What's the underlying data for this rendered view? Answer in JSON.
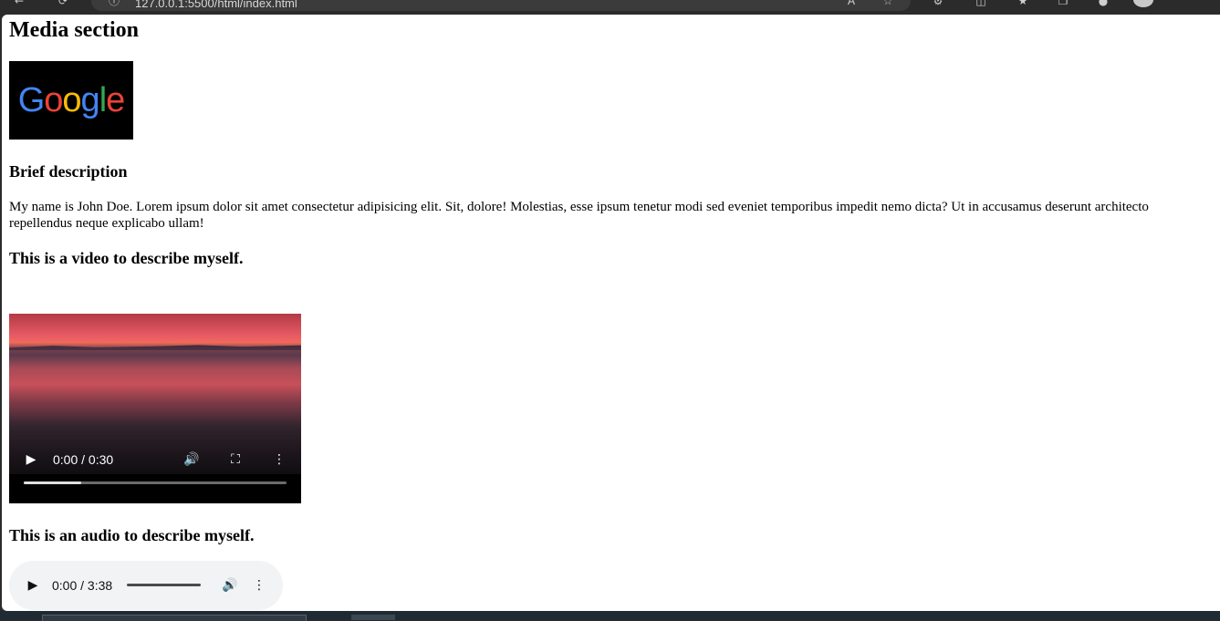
{
  "browser": {
    "url": "127.0.0.1:5500/html/index.html"
  },
  "page": {
    "heading": "Media section",
    "logo": {
      "word": "Google",
      "letter_colors": [
        "#4285f4",
        "#ea4335",
        "#fbbc05",
        "#4285f4",
        "#34a853",
        "#ea4335"
      ]
    },
    "brief_heading": "Brief description",
    "description": "My name is John Doe. Lorem ipsum dolor sit amet consectetur adipisicing elit. Sit, dolore! Molestias, esse ipsum tenetur modi sed eveniet temporibus impedit nemo dicta? Ut in accusamus deserunt architecto repellendus neque explicabo ullam!",
    "video_heading": "This is a video to describe myself.",
    "video": {
      "time": "0:00 / 0:30",
      "buffered_fraction": 0.22,
      "icons": [
        "play-icon",
        "volume-icon",
        "fullscreen-icon",
        "more-vert-icon"
      ]
    },
    "audio_heading": "This is an audio to describe myself.",
    "audio": {
      "time": "0:00 / 3:38",
      "icons": [
        "play-icon",
        "volume-icon",
        "more-vert-icon"
      ]
    }
  },
  "colors": {
    "page_background": "#ffffff",
    "chrome_background": "#2b2b2b",
    "audio_player_background": "#f1f3f4"
  }
}
